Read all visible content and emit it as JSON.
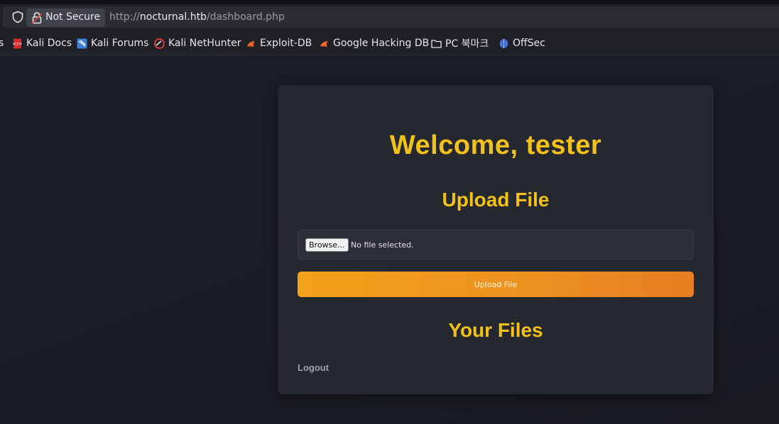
{
  "browser": {
    "security_label": "Not Secure",
    "url_scheme": "http://",
    "url_host": "nocturnal.htb",
    "url_path": "/dashboard.php",
    "bookmarks": [
      {
        "label": "s",
        "icon": "bookmark-truncated"
      },
      {
        "label": "Kali Docs",
        "icon": "kali-docs-icon"
      },
      {
        "label": "Kali Forums",
        "icon": "kali-forums-icon"
      },
      {
        "label": "Kali NetHunter",
        "icon": "nethunter-icon"
      },
      {
        "label": "Exploit-DB",
        "icon": "exploit-db-icon"
      },
      {
        "label": "Google Hacking DB",
        "icon": "ghdb-icon"
      },
      {
        "label": "PC 북마크",
        "icon": "folder-icon"
      },
      {
        "label": "OffSec",
        "icon": "offsec-icon"
      }
    ]
  },
  "dashboard": {
    "welcome": "Welcome, tester",
    "upload_heading": "Upload File",
    "browse_label": "Browse...",
    "no_file_text": "No file selected.",
    "upload_button": "Upload File",
    "files_heading": "Your Files",
    "logout_label": "Logout"
  },
  "colors": {
    "accent_yellow": "#f2c21b",
    "button_orange": "#ec9020",
    "card_bg": "#262830",
    "page_bg": "#1a1d24"
  }
}
